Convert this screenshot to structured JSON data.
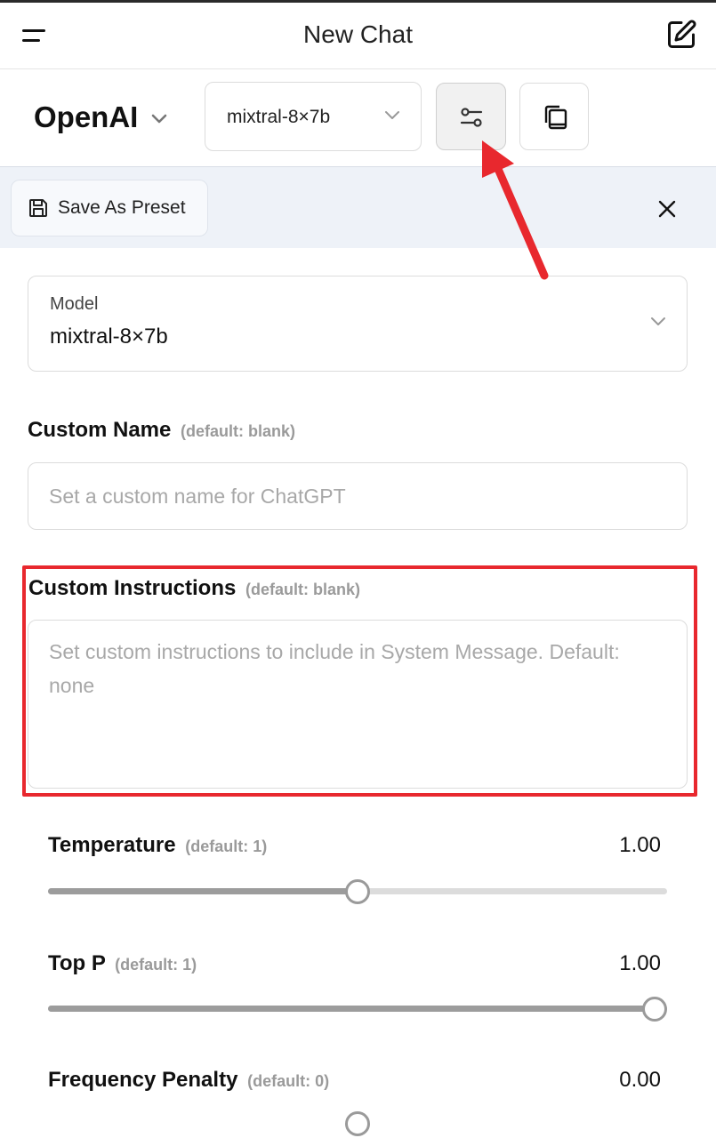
{
  "header": {
    "title": "New Chat"
  },
  "toolbar": {
    "endpoint_label": "OpenAI",
    "model_select_label": "mixtral-8×7b"
  },
  "panel": {
    "save_preset_label": "Save As Preset"
  },
  "form": {
    "model": {
      "label": "Model",
      "value": "mixtral-8×7b"
    },
    "custom_name": {
      "label": "Custom Name",
      "default_hint": "(default: blank)",
      "placeholder": "Set a custom name for ChatGPT"
    },
    "custom_instructions": {
      "label": "Custom Instructions",
      "default_hint": "(default: blank)",
      "placeholder": "Set custom instructions to include in System Message. Default: none"
    },
    "temperature": {
      "label": "Temperature",
      "default_hint": "(default: 1)",
      "value_display": "1.00",
      "fraction": 0.5
    },
    "top_p": {
      "label": "Top P",
      "default_hint": "(default: 1)",
      "value_display": "1.00",
      "fraction": 1.0
    },
    "frequency_penalty": {
      "label": "Frequency Penalty",
      "default_hint": "(default: 0)",
      "value_display": "0.00",
      "fraction": 0.5
    }
  },
  "colors": {
    "annotation_red": "#e8282e",
    "panel_bg": "#eef2f8",
    "slider_fill": "#9c9c9c",
    "slider_track": "#dcdcdc"
  },
  "icons": [
    "menu-icon",
    "edit-icon",
    "chevron-down-icon",
    "sliders-icon",
    "copy-preset-icon",
    "save-icon",
    "close-icon"
  ]
}
